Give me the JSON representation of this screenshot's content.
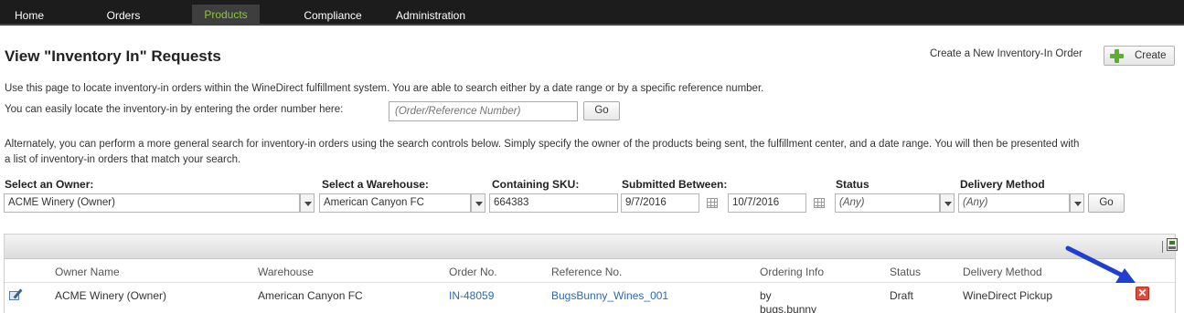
{
  "nav": {
    "items": [
      {
        "label": "Home"
      },
      {
        "label": "Orders"
      },
      {
        "label": "Products"
      },
      {
        "label": "Compliance"
      },
      {
        "label": "Administration"
      }
    ],
    "active": "Products"
  },
  "header": {
    "title": "View \"Inventory In\" Requests",
    "create_text": "Create a New Inventory-In Order",
    "create_button": "Create"
  },
  "intro": {
    "line1": "Use this page to locate inventory-in orders within the WineDirect fulfillment system. You are able to search either by a date range or by a specific reference number.",
    "line2": "You can easily locate the inventory-in by entering the order number here:",
    "order_placeholder": "(Order/Reference Number)",
    "go_label": "Go",
    "alt_line1": "Alternately, you can perform a more general search for inventory-in orders using the search controls below. Simply specify the owner of the products being sent, the fulfillment center, and a date range. You will then be presented with",
    "alt_line2": "a list of inventory-in orders that match your search."
  },
  "filters": {
    "owner_label": "Select an Owner:",
    "owner_value": "ACME Winery (Owner)",
    "warehouse_label": "Select a Warehouse:",
    "warehouse_value": "American Canyon FC",
    "sku_label": "Containing SKU:",
    "sku_value": "664383",
    "submitted_label": "Submitted Between:",
    "date_from": "9/7/2016",
    "date_to": "10/7/2016",
    "status_label": "Status",
    "status_value": "(Any)",
    "delivery_label": "Delivery Method",
    "delivery_value": "(Any)",
    "go_label": "Go"
  },
  "table": {
    "columns": [
      "Owner Name",
      "Warehouse",
      "Order No.",
      "Reference No.",
      "Ordering Info",
      "Status",
      "Delivery Method"
    ],
    "rows": [
      {
        "owner": "ACME Winery (Owner)",
        "warehouse": "American Canyon FC",
        "order_no": "IN-48059",
        "reference_no": "BugsBunny_Wines_001",
        "ordering_info_1": "by",
        "ordering_info_2": "bugs.bunny",
        "status": "Draft",
        "delivery_method": "WineDirect Pickup"
      }
    ]
  },
  "colors": {
    "nav_bg": "#1c1c1c",
    "nav_active_text": "#8cc63f",
    "link": "#2a6ab3",
    "delete_icon": "#e04b3a",
    "annotation_arrow": "#1f3fd1"
  }
}
